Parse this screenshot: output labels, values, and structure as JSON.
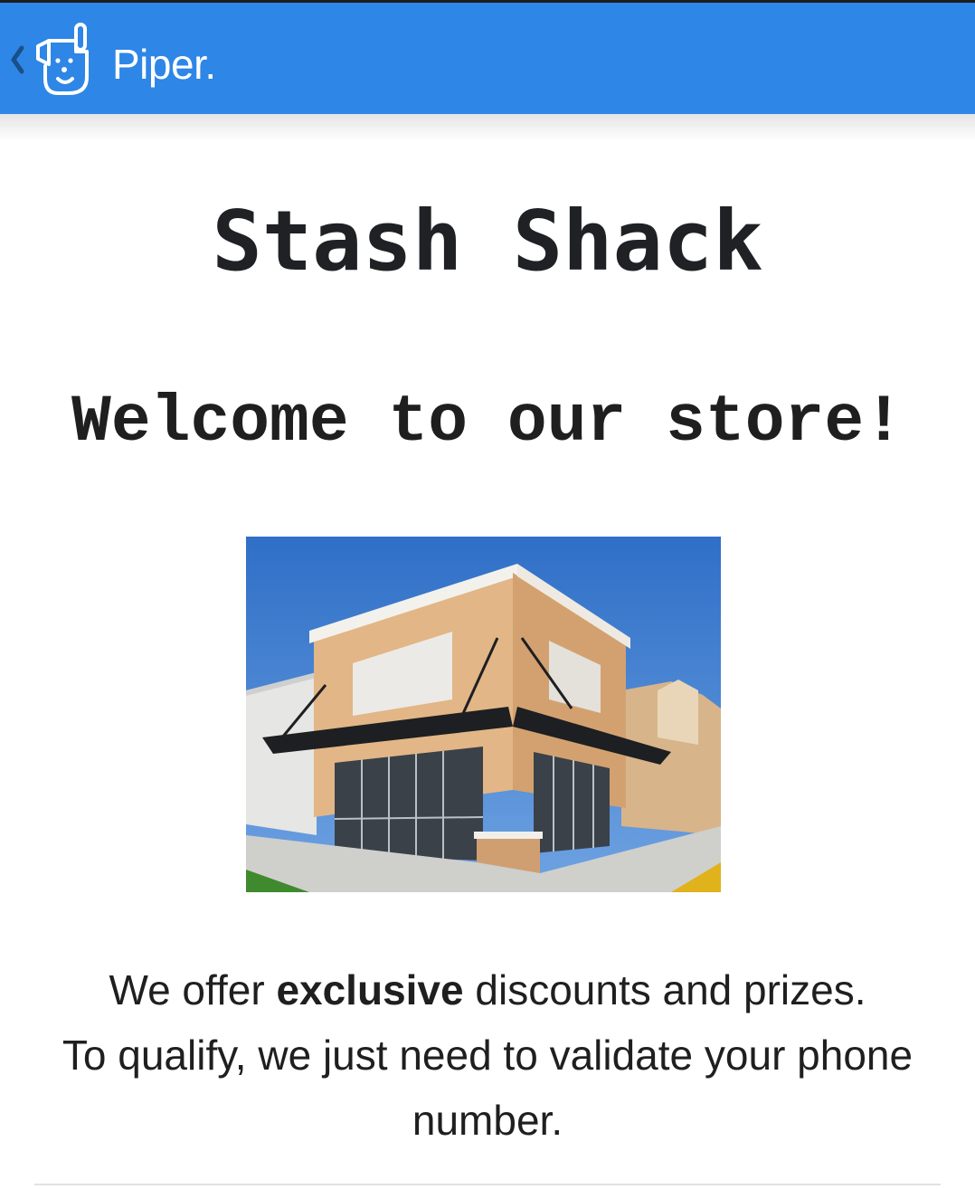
{
  "appbar": {
    "back_icon": "chevron-left-icon",
    "logo_icon": "piper-dog-icon",
    "title": "Piper.",
    "color": "#2e86e6"
  },
  "page": {
    "store_name": "Stash Shack",
    "welcome": "Welcome to our store!",
    "image": "storefront-photo",
    "offer": {
      "line1_before": "We offer ",
      "line1_bold": "exclusive",
      "line1_after": " discounts and prizes.",
      "line2": "To qualify, we just need to validate your phone number."
    }
  }
}
